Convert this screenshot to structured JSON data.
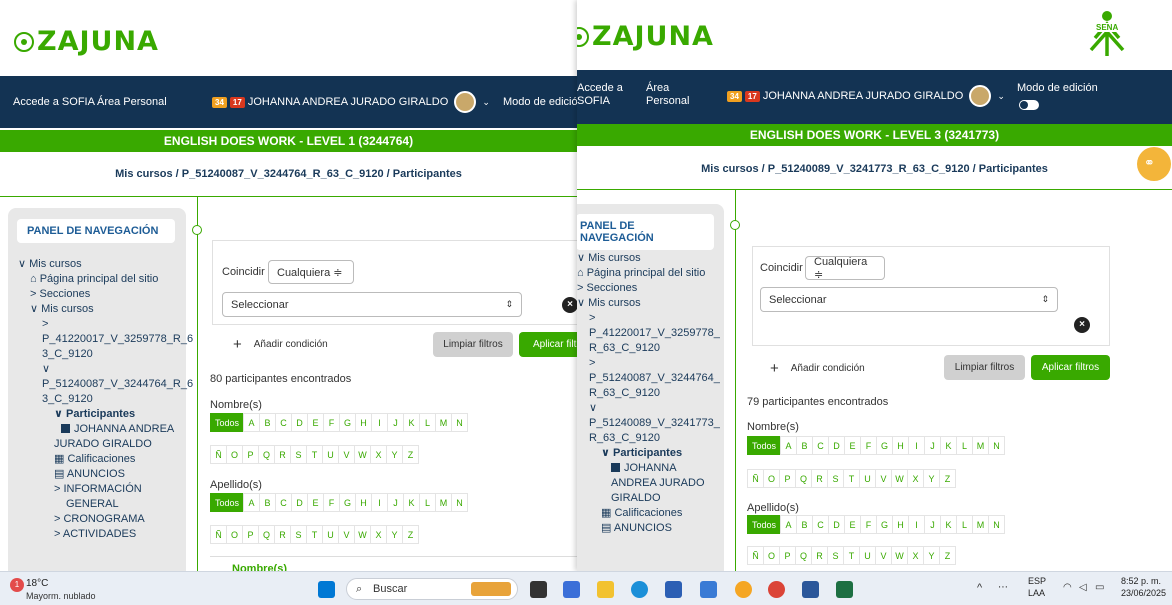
{
  "left_window": {
    "logo": "ZAJUNA",
    "nav": {
      "sofia": "Accede a SOFIA",
      "personal": "Área Personal",
      "badge1": "34",
      "badge2": "17",
      "user": "JOHANNA ANDREA JURADO GIRALDO",
      "edit_mode": "Modo de edición"
    },
    "course_title": "ENGLISH DOES WORK - LEVEL 1 (3244764)",
    "breadcrumb": {
      "a": "Mis cursos",
      "sep": "/",
      "b": "P_51240087_V_3244764_R_63_C_9120",
      "c": "Participantes"
    },
    "panel_title": "PANEL DE NAVEGACIÓN",
    "tree": [
      "∨ Mis cursos",
      "⌂ Página principal del sitio",
      "> Secciones",
      "∨ Mis cursos",
      ">",
      "P_41220017_V_3259778_R_6",
      "3_C_9120",
      "∨",
      "P_51240087_V_3244764_R_6",
      "3_C_9120",
      "∨ Participantes",
      "JOHANNA ANDREA",
      "JURADO GIRALDO",
      "Calificaciones",
      "ANUNCIOS",
      "> INFORMACIÓN",
      "GENERAL",
      "> CRONOGRAMA",
      "> ACTIVIDADES"
    ],
    "filter": {
      "match_label": "Coincidir",
      "match_value": "Cualquiera ≑",
      "select_placeholder": "Seleccionar",
      "add_condition": "Añadir condición",
      "clear": "Limpiar filtros",
      "apply": "Aplicar filtros"
    },
    "count": "80 participantes encontrados",
    "first_name_label": "Nombre(s)",
    "last_name_label": "Apellido(s)",
    "table_header": "Nombre(s)"
  },
  "right_window": {
    "logo": "ZAJUNA",
    "sena_logo": "SENA",
    "nav": {
      "sofia": "Accede a",
      "sofia2": "SOFIA",
      "personal": "Área",
      "personal2": "Personal",
      "badge1": "34",
      "badge2": "17",
      "user": "JOHANNA ANDREA JURADO GIRALDO",
      "edit_mode": "Modo de edición"
    },
    "course_title": "ENGLISH DOES WORK - LEVEL 3 (3241773)",
    "breadcrumb": {
      "a": "Mis cursos",
      "sep": "/",
      "b": "P_51240089_V_3241773_R_63_C_9120",
      "c": "Participantes"
    },
    "panel_title": "PANEL DE NAVEGACIÓN",
    "tree": [
      "∨ Mis cursos",
      "⌂ Página principal del sitio",
      "> Secciones",
      "∨ Mis cursos",
      ">",
      "P_41220017_V_3259778_",
      "R_63_C_9120",
      ">",
      "P_51240087_V_3244764_",
      "R_63_C_9120",
      "∨",
      "P_51240089_V_3241773_",
      "R_63_C_9120",
      "∨ Participantes",
      "JOHANNA",
      "ANDREA JURADO",
      "GIRALDO",
      "Calificaciones",
      "ANUNCIOS"
    ],
    "filter": {
      "match_label": "Coincidir",
      "match_value": "Cualquiera ≑",
      "select_placeholder": "Seleccionar",
      "add_condition": "Añadir condición",
      "clear": "Limpiar filtros",
      "apply": "Aplicar filtros"
    },
    "count": "79 participantes encontrados",
    "first_name_label": "Nombre(s)",
    "last_name_label": "Apellido(s)"
  },
  "alphabet_row1": [
    "Todos",
    "A",
    "B",
    "C",
    "D",
    "E",
    "F",
    "G",
    "H",
    "I",
    "J",
    "K",
    "L",
    "M",
    "N"
  ],
  "alphabet_row2": [
    "Ñ",
    "O",
    "P",
    "Q",
    "R",
    "S",
    "T",
    "U",
    "V",
    "W",
    "X",
    "Y",
    "Z"
  ],
  "taskbar": {
    "weather_temp": "18°C",
    "weather_desc": "Mayorm. nublado",
    "search": "Buscar",
    "lang1": "ESP",
    "lang2": "LAA",
    "time": "8:52 p. m.",
    "date": "23/06/2025",
    "notif": "1"
  },
  "colors": {
    "navy": "#133353",
    "green": "#39a900"
  }
}
